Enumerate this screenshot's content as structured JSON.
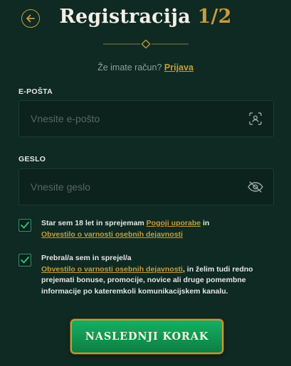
{
  "header": {
    "back_icon": "arrow-left-icon",
    "title": "Registracija",
    "step": "1/2"
  },
  "account": {
    "question": "Že imate račun?",
    "login_link": "Prijava"
  },
  "email": {
    "label": "E-POŠTA",
    "placeholder": "Vnesite e-pošto",
    "icon": "contact-scan-icon"
  },
  "password": {
    "label": "GESLO",
    "placeholder": "Vnesite geslo",
    "icon": "eye-off-icon"
  },
  "terms": {
    "checked": true,
    "text_before": "Star sem 18 let in sprejemam",
    "terms_link": "Pogoji uporabe",
    "text_middle": "in",
    "privacy_link": "Obvestilo o varnosti osebnih dejavnosti"
  },
  "marketing": {
    "checked": true,
    "text_before": "Prebral/a sem in sprejel/a",
    "privacy_link": "Obvestilo o varnosti osebnih dejavnosti",
    "text_after": ", in želim tudi redno prejemati bonuse, promocije, novice ali druge pomembne informacije po kateremkoli komunikacijskem kanalu."
  },
  "next_button": {
    "label": "NASLEDNJI KORAK"
  },
  "colors": {
    "background": "#0e2a22",
    "gold": "#c89b3c",
    "button_green": "#14a45b",
    "checkbox_border": "#3a8d72"
  }
}
